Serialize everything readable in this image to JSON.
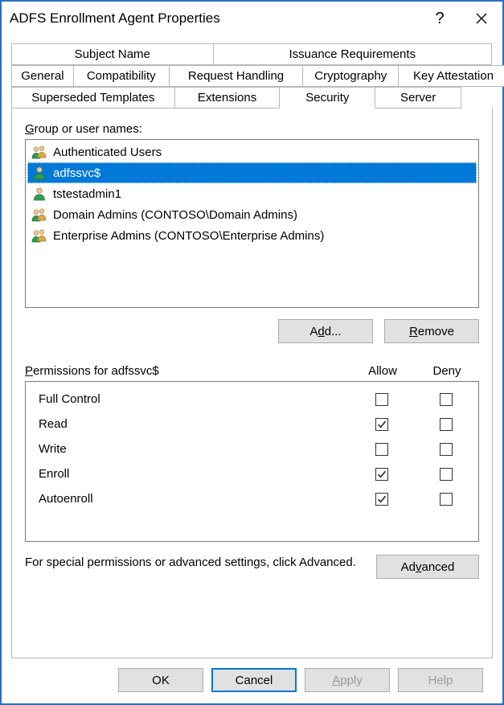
{
  "window": {
    "title": "ADFS Enrollment Agent Properties"
  },
  "tabs": {
    "row1": [
      {
        "label": "Subject Name",
        "active": false
      },
      {
        "label": "Issuance Requirements",
        "active": false
      }
    ],
    "row2": [
      {
        "label": "General",
        "active": false
      },
      {
        "label": "Compatibility",
        "active": false
      },
      {
        "label": "Request Handling",
        "active": false
      },
      {
        "label": "Cryptography",
        "active": false
      },
      {
        "label": "Key Attestation",
        "active": false
      }
    ],
    "row3": [
      {
        "label": "Superseded Templates",
        "active": false
      },
      {
        "label": "Extensions",
        "active": false
      },
      {
        "label": "Security",
        "active": true
      },
      {
        "label": "Server",
        "active": false
      }
    ]
  },
  "security": {
    "group_label": "Group or user names:",
    "groups": [
      {
        "icon": "users",
        "name": "Authenticated Users",
        "selected": false
      },
      {
        "icon": "user",
        "name": "adfssvc$",
        "selected": true
      },
      {
        "icon": "user",
        "name": "tstestadmin1",
        "selected": false
      },
      {
        "icon": "users",
        "name": "Domain Admins (CONTOSO\\Domain Admins)",
        "selected": false
      },
      {
        "icon": "users",
        "name": "Enterprise Admins (CONTOSO\\Enterprise Admins)",
        "selected": false
      }
    ],
    "add_label": "Add...",
    "remove_label": "Remove",
    "permissions_label": "Permissions for adfssvc$",
    "allow_label": "Allow",
    "deny_label": "Deny",
    "permissions": [
      {
        "name": "Full Control",
        "allow": false,
        "deny": false
      },
      {
        "name": "Read",
        "allow": true,
        "deny": false
      },
      {
        "name": "Write",
        "allow": false,
        "deny": false
      },
      {
        "name": "Enroll",
        "allow": true,
        "deny": false
      },
      {
        "name": "Autoenroll",
        "allow": true,
        "deny": false
      }
    ],
    "advanced_text": "For special permissions or advanced settings, click Advanced.",
    "advanced_btn": "Advanced"
  },
  "dialog_buttons": {
    "ok": "OK",
    "cancel": "Cancel",
    "apply": "Apply",
    "help": "Help"
  },
  "mnemonics": {
    "group_label": "G",
    "add": "d",
    "remove": "R",
    "permissions_label": "P",
    "advanced": "v",
    "apply": "A"
  }
}
